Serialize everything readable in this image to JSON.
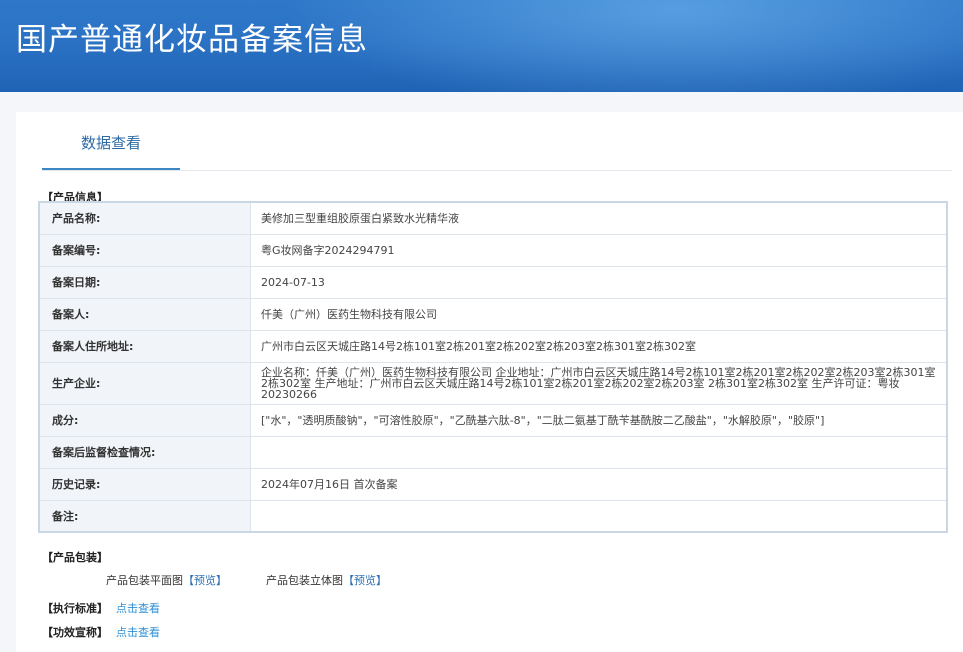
{
  "header": {
    "title": "国产普通化妆品备案信息"
  },
  "tabs": [
    {
      "label": "数据查看"
    }
  ],
  "product_section": {
    "label": "【产品信息】",
    "rows": [
      {
        "key": "产品名称:",
        "value": "美修加三型重组胶原蛋白紧致水光精华液"
      },
      {
        "key": "备案编号:",
        "value": "粤G妆网备字2024294791"
      },
      {
        "key": "备案日期:",
        "value": "2024-07-13"
      },
      {
        "key": "备案人:",
        "value": "仟美（广州）医药生物科技有限公司"
      },
      {
        "key": "备案人住所地址:",
        "value": "广州市白云区天城庄路14号2栋101室2栋201室2栋202室2栋203室2栋301室2栋302室"
      },
      {
        "key": "生产企业:",
        "value": "企业名称：仟美（广州）医药生物科技有限公司 企业地址：广州市白云区天城庄路14号2栋101室2栋201室2栋202室2栋203室2栋301室2栋302室 生产地址：广州市白云区天城庄路14号2栋101室2栋201室2栋202室2栋203室 2栋301室2栋302室 生产许可证：粤妆20230266"
      },
      {
        "key": "成分:",
        "value": "[\"水\"，\"透明质酸钠\"，\"可溶性胶原\"，\"乙酰基六肽-8\"，\"二肽二氨基丁酰苄基酰胺二乙酸盐\"，\"水解胶原\"，\"胶原\"]"
      },
      {
        "key": "备案后监督检查情况:",
        "value": ""
      },
      {
        "key": "历史记录:",
        "value": "2024年07月16日 首次备案"
      },
      {
        "key": "备注:",
        "value": ""
      }
    ]
  },
  "packaging_section": {
    "label": "【产品包装】",
    "items": [
      {
        "label": "产品包装平面图",
        "link": "【预览】"
      },
      {
        "label": "产品包装立体图",
        "link": "【预览】"
      }
    ]
  },
  "standard_section": {
    "label": "【执行标准】",
    "link": "点击查看"
  },
  "efficacy_section": {
    "label": "【功效宣称】",
    "link": "点击查看"
  }
}
